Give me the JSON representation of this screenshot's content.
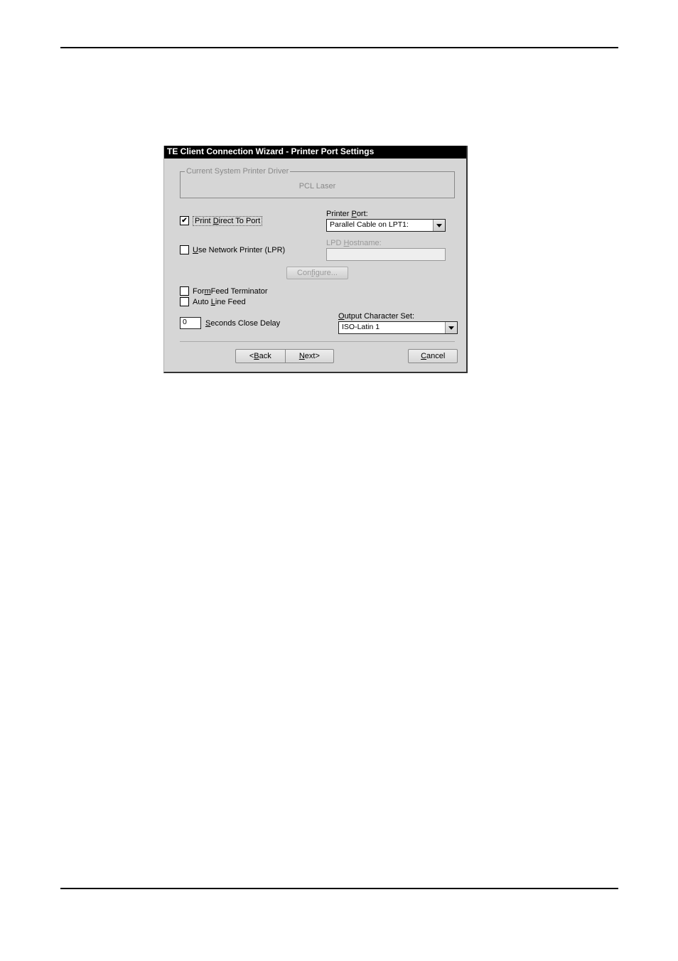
{
  "dialog": {
    "title": "TE Client Connection Wizard - Printer Port Settings",
    "group": {
      "label": "Current System Printer Driver",
      "value": "PCL Laser"
    },
    "printDirect": {
      "checked": true,
      "label": "Print Direct To Port"
    },
    "printerPort": {
      "label": "Printer Port:",
      "value": "Parallel Cable on LPT1:"
    },
    "useNetwork": {
      "checked": false,
      "label": "Use Network Printer (LPR)"
    },
    "lpdHostname": {
      "label": "LPD Hostname:",
      "value": ""
    },
    "configure": "Configure...",
    "formFeed": {
      "checked": false,
      "label": "FormFeed Terminator"
    },
    "autoLine": {
      "checked": false,
      "label": "Auto Line Feed"
    },
    "secondsDelay": {
      "value": "0",
      "label": "Seconds Close Delay"
    },
    "outputCharset": {
      "label": "Output Character Set:",
      "value": "ISO-Latin 1"
    },
    "buttons": {
      "back": "<Back",
      "next": "Next>",
      "cancel": "Cancel"
    }
  }
}
